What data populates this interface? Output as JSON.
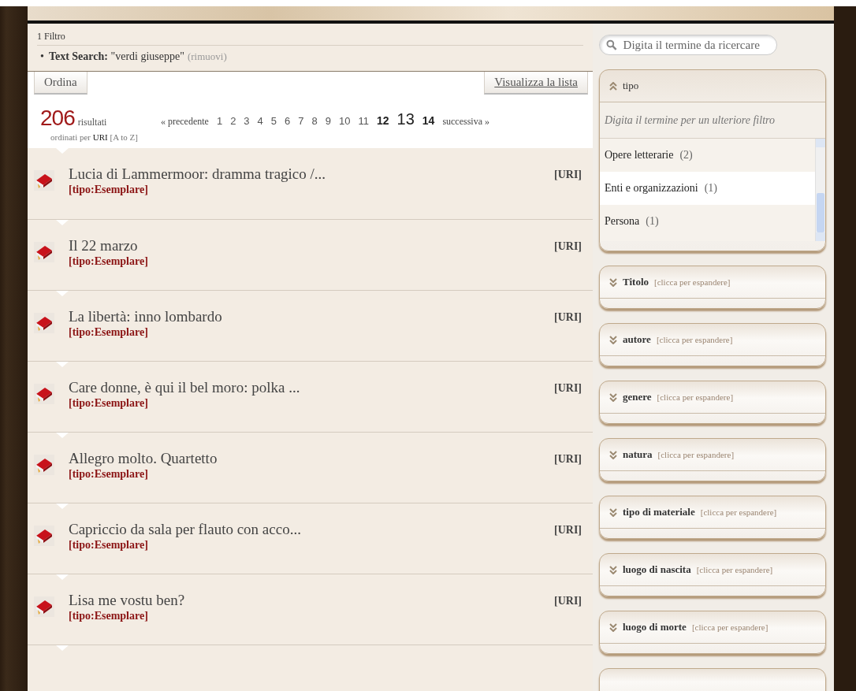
{
  "filters": {
    "title": "1 Filtro",
    "items": [
      {
        "bullet": "•",
        "label": "Text Search:",
        "value": "\"verdi giuseppe\"",
        "remove": "(rimuovi)"
      }
    ]
  },
  "toolbar": {
    "sort": "Ordina",
    "view": "Visualizza la lista"
  },
  "summary": {
    "count": "206",
    "count_label": "risultati",
    "sorted_prefix": "ordinati per",
    "sorted_field": "URI",
    "sorted_order": "[A to Z]"
  },
  "pagination": {
    "previous": "« precedente",
    "next": "successiva »",
    "pages": [
      {
        "label": "1",
        "selected": false
      },
      {
        "label": "2",
        "selected": false
      },
      {
        "label": "3",
        "selected": false
      },
      {
        "label": "4",
        "selected": false
      },
      {
        "label": "5",
        "selected": false
      },
      {
        "label": "6",
        "selected": false
      },
      {
        "label": "7",
        "selected": false
      },
      {
        "label": "8",
        "selected": false
      },
      {
        "label": "9",
        "selected": false
      },
      {
        "label": "10",
        "selected": false
      },
      {
        "label": "11",
        "selected": false
      },
      {
        "label": "12",
        "selected": false
      },
      {
        "label": "13",
        "selected": true
      },
      {
        "label": "14",
        "selected": false
      }
    ]
  },
  "results": [
    {
      "title": "Lucia di Lammermoor: dramma tragico /...",
      "type": "[tipo:Esemplare]",
      "link": "[URI]"
    },
    {
      "title": "Il 22 marzo",
      "type": "[tipo:Esemplare]",
      "link": "[URI]"
    },
    {
      "title": "La libertà: inno lombardo",
      "type": "[tipo:Esemplare]",
      "link": "[URI]"
    },
    {
      "title": "Care donne, è qui il bel moro: polka ...",
      "type": "[tipo:Esemplare]",
      "link": "[URI]"
    },
    {
      "title": "Allegro molto. Quartetto",
      "type": "[tipo:Esemplare]",
      "link": "[URI]"
    },
    {
      "title": "Capriccio da sala per flauto con acco...",
      "type": "[tipo:Esemplare]",
      "link": "[URI]"
    },
    {
      "title": "Lisa me vostu ben?",
      "type": "[tipo:Esemplare]",
      "link": "[URI]"
    }
  ],
  "search": {
    "placeholder": "Digita il termine da ricercare"
  },
  "facets": [
    {
      "title": "tipo",
      "expanded": true,
      "filter_placeholder": "Digita il termine per un ulteriore filtro",
      "values": [
        {
          "label": "Opere letterarie",
          "count": "(2)",
          "selected": false
        },
        {
          "label": "Enti e organizzazioni",
          "count": "(1)",
          "selected": true
        },
        {
          "label": "Persona",
          "count": "(1)",
          "selected": false
        }
      ]
    },
    {
      "title": "Titolo",
      "expanded": false,
      "hint": "[clicca per espandere]"
    },
    {
      "title": "autore",
      "expanded": false,
      "hint": "[clicca per espandere]"
    },
    {
      "title": "genere",
      "expanded": false,
      "hint": "[clicca per espandere]"
    },
    {
      "title": "natura",
      "expanded": false,
      "hint": "[clicca per espandere]"
    },
    {
      "title": "tipo di materiale",
      "expanded": false,
      "hint": "[clicca per espandere]"
    },
    {
      "title": "luogo di nascita",
      "expanded": false,
      "hint": "[clicca per espandere]"
    },
    {
      "title": "luogo di morte",
      "expanded": false,
      "hint": "[clicca per espandere]"
    }
  ]
}
